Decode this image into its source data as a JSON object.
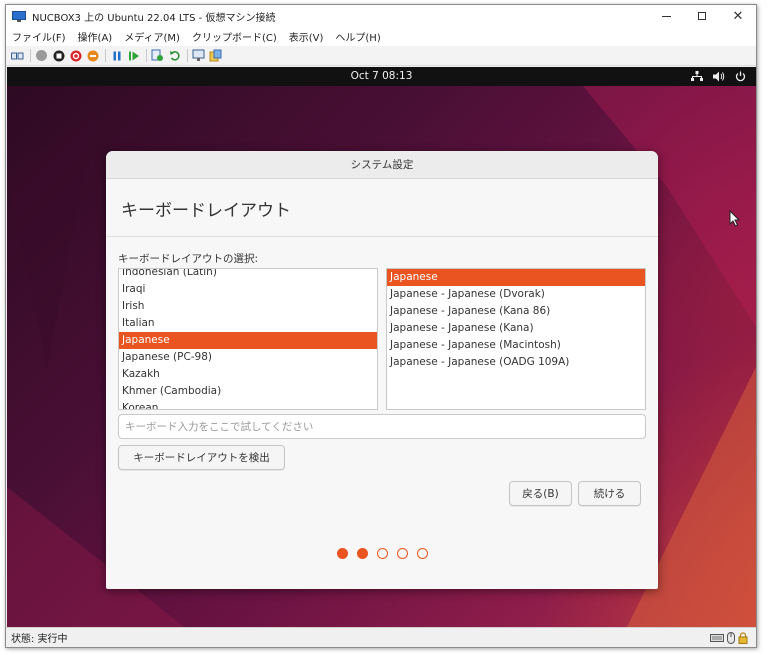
{
  "window": {
    "title": "NUCBOX3 上の Ubuntu 22.04 LTS - 仮想マシン接続"
  },
  "menu": {
    "items": [
      "ファイル(F)",
      "操作(A)",
      "メディア(M)",
      "クリップボード(C)",
      "表示(V)",
      "ヘルプ(H)"
    ]
  },
  "toolbar": {
    "icons": [
      "ctrl-alt-del-icon",
      "start-icon",
      "turn-off-icon",
      "shutdown-icon",
      "save-icon",
      "pause-icon",
      "resume-icon",
      "checkpoint-icon",
      "revert-icon",
      "enhanced-session-icon",
      "share-icon"
    ]
  },
  "vm": {
    "panel": {
      "clock": "Oct 7  08:13"
    },
    "dialog": {
      "header": "システム設定",
      "title": "キーボードレイアウト",
      "select_label": "キーボードレイアウトの選択:",
      "layouts": [
        "Indonesian (Latin)",
        "Iraqi",
        "Irish",
        "Italian",
        "Japanese",
        "Japanese (PC-98)",
        "Kazakh",
        "Khmer (Cambodia)",
        "Korean"
      ],
      "selected_layout": "Japanese",
      "variants": [
        "Japanese",
        "Japanese - Japanese (Dvorak)",
        "Japanese - Japanese (Kana 86)",
        "Japanese - Japanese (Kana)",
        "Japanese - Japanese (Macintosh)",
        "Japanese - Japanese (OADG 109A)"
      ],
      "selected_variant": "Japanese",
      "test_input": {
        "value": "",
        "placeholder": "キーボード入力をここで試してください"
      },
      "detect_label": "キーボードレイアウトを検出",
      "back_label": "戻る(B)",
      "continue_label": "続ける",
      "steps_total": 5,
      "steps_completed": 2
    }
  },
  "status": {
    "text": "状態: 実行中"
  },
  "colors": {
    "accent": "#e95420",
    "panel": "#111111"
  }
}
